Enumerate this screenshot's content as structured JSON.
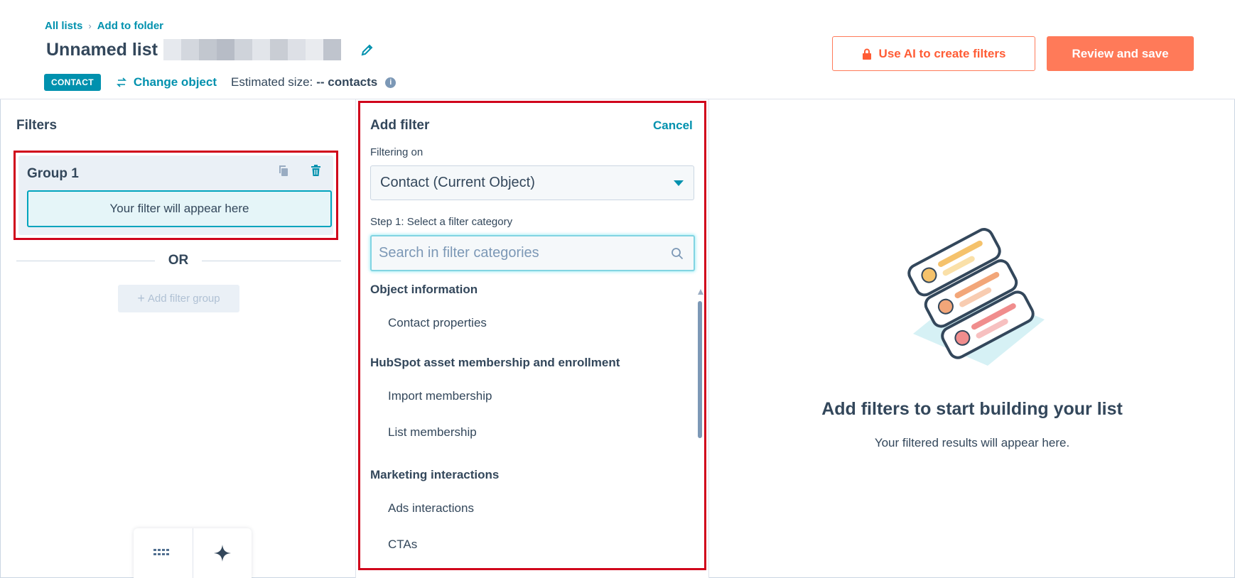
{
  "breadcrumb": {
    "all_lists": "All lists",
    "separator": "›",
    "add_to_folder": "Add to folder"
  },
  "list": {
    "title": "Unnamed list"
  },
  "object": {
    "badge": "CONTACT",
    "change_label": "Change object",
    "estimated_label": "Estimated size:",
    "estimated_value": "-- contacts"
  },
  "actions": {
    "ai_label": "Use AI to create filters",
    "save_label": "Review and save"
  },
  "filters": {
    "title": "Filters",
    "group_title": "Group 1",
    "placeholder": "Your filter will appear here",
    "or_label": "OR",
    "add_group_label": "Add filter group"
  },
  "add_filter": {
    "title": "Add filter",
    "cancel": "Cancel",
    "filtering_on_label": "Filtering on",
    "filtering_on_value": "Contact (Current Object)",
    "step_label": "Step 1: Select a filter category",
    "search_placeholder": "Search in filter categories",
    "categories": [
      {
        "heading": "Object information",
        "items": [
          "Contact properties"
        ]
      },
      {
        "heading": "HubSpot asset membership and enrollment",
        "items": [
          "Import membership",
          "List membership"
        ]
      },
      {
        "heading": "Marketing interactions",
        "items": [
          "Ads interactions",
          "CTAs"
        ]
      }
    ]
  },
  "empty_state": {
    "title": "Add filters to start building your list",
    "subtitle": "Your filtered results will appear here."
  },
  "colors": {
    "accent": "#0091ae",
    "primary_button": "#ff7a59",
    "highlight": "#d0021b",
    "text": "#33475b"
  }
}
